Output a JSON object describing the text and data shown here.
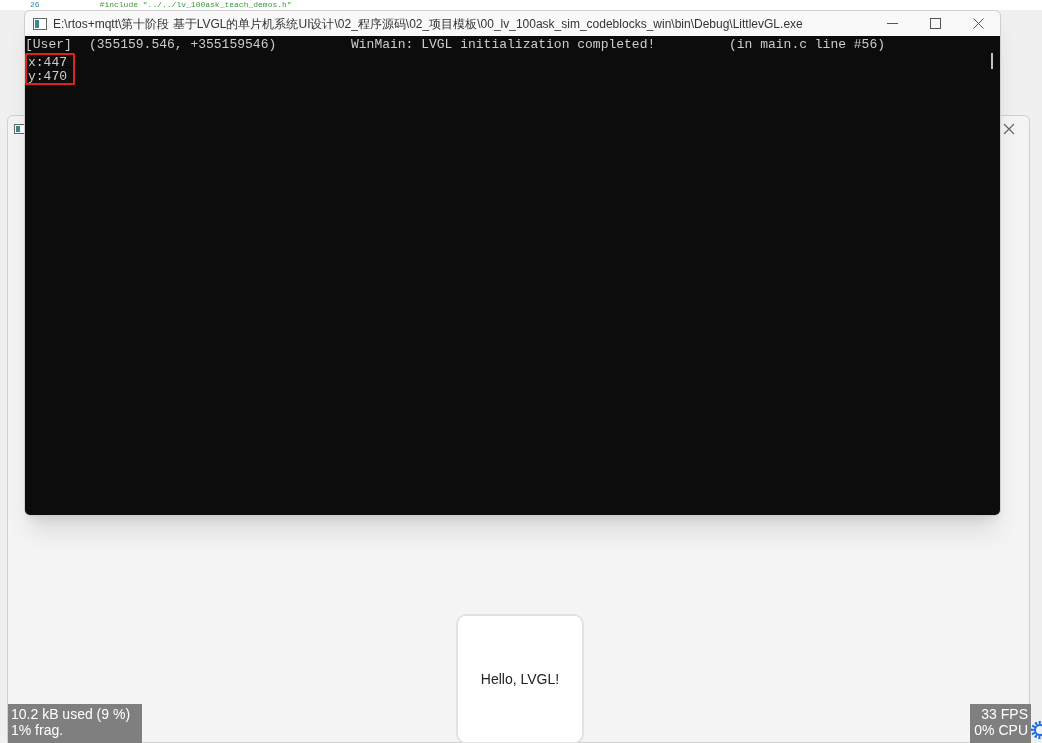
{
  "background_editor": {
    "line_number": "26",
    "code": "#include \"../../lv_100ask_teach_demos.h\""
  },
  "console_window": {
    "title": "E:\\rtos+mqtt\\第十阶段 基于LVGL的单片机系统UI设计\\02_程序源码\\02_项目模板\\00_lv_100ask_sim_codeblocks_win\\bin\\Debug\\LittlevGL.exe",
    "lines": [
      {
        "kind": "log",
        "columns": [
          "[User]",
          "(355159.546, +355159546)",
          "WinMain: LVGL initialization completed!",
          "(in main.c line #56)"
        ]
      },
      {
        "kind": "plain",
        "text": "x:447",
        "highlighted": true
      },
      {
        "kind": "plain",
        "text": "y:470",
        "highlighted": true
      }
    ]
  },
  "simulator_window": {
    "card": {
      "label": "Hello, LVGL!"
    },
    "memory_monitor": [
      "10.2 kB used (9 %)",
      "1% frag."
    ],
    "performance_monitor": [
      "33 FPS",
      "0% CPU"
    ]
  }
}
